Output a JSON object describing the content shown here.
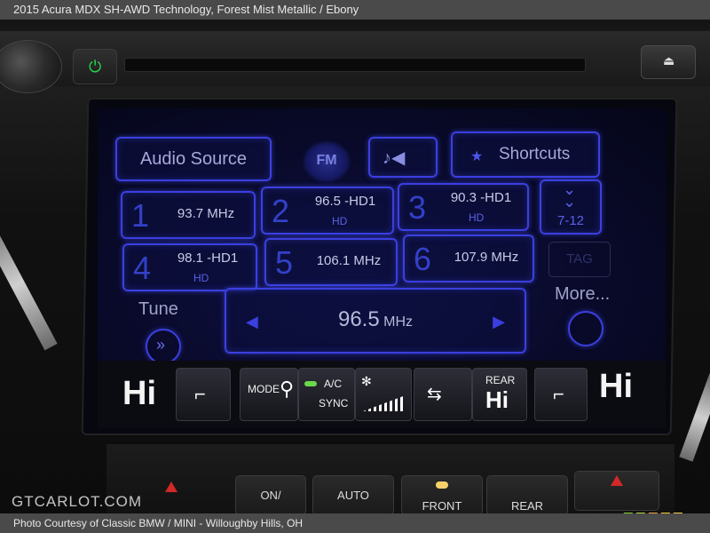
{
  "caption": {
    "top": "2015 Acura MDX SH-AWD Technology,  Forest Mist Metallic / Ebony",
    "bottom": "Photo Courtesy of Classic BMW / MINI - Willoughby Hills, OH"
  },
  "watermark": "GTCARLOT.COM",
  "screen": {
    "audio_source_label": "Audio Source",
    "fm_label": "FM",
    "shortcuts_label": "Shortcuts",
    "presets": [
      {
        "number": "1",
        "freq": "93.7 MHz",
        "hd": ""
      },
      {
        "number": "2",
        "freq": "96.5 -HD1",
        "hd": "HD"
      },
      {
        "number": "3",
        "freq": "90.3 -HD1",
        "hd": "HD"
      },
      {
        "number": "4",
        "freq": "98.1 -HD1",
        "hd": "HD"
      },
      {
        "number": "5",
        "freq": "106.1 MHz",
        "hd": ""
      },
      {
        "number": "6",
        "freq": "107.9 MHz",
        "hd": ""
      }
    ],
    "page_label": "7-12",
    "tag_label": "TAG",
    "tune_label": "Tune",
    "more_label": "More...",
    "current_freq": "96.5",
    "current_unit": "MHz",
    "climate": {
      "left_temp": "Hi",
      "mode_label": "MODE",
      "ac_label": "A/C",
      "sync_label": "SYNC",
      "rear_label": "REAR",
      "rear_temp": "Hi",
      "right_temp": "Hi"
    }
  },
  "console": {
    "front_label": "FRONT",
    "rear_label": "REAR",
    "on_label": "ON/",
    "auto_label": "AUTO"
  },
  "colors": {
    "screen_accent": "#3b3fe0",
    "power_led": "#27d94a",
    "ac_led": "#6bd94a"
  }
}
